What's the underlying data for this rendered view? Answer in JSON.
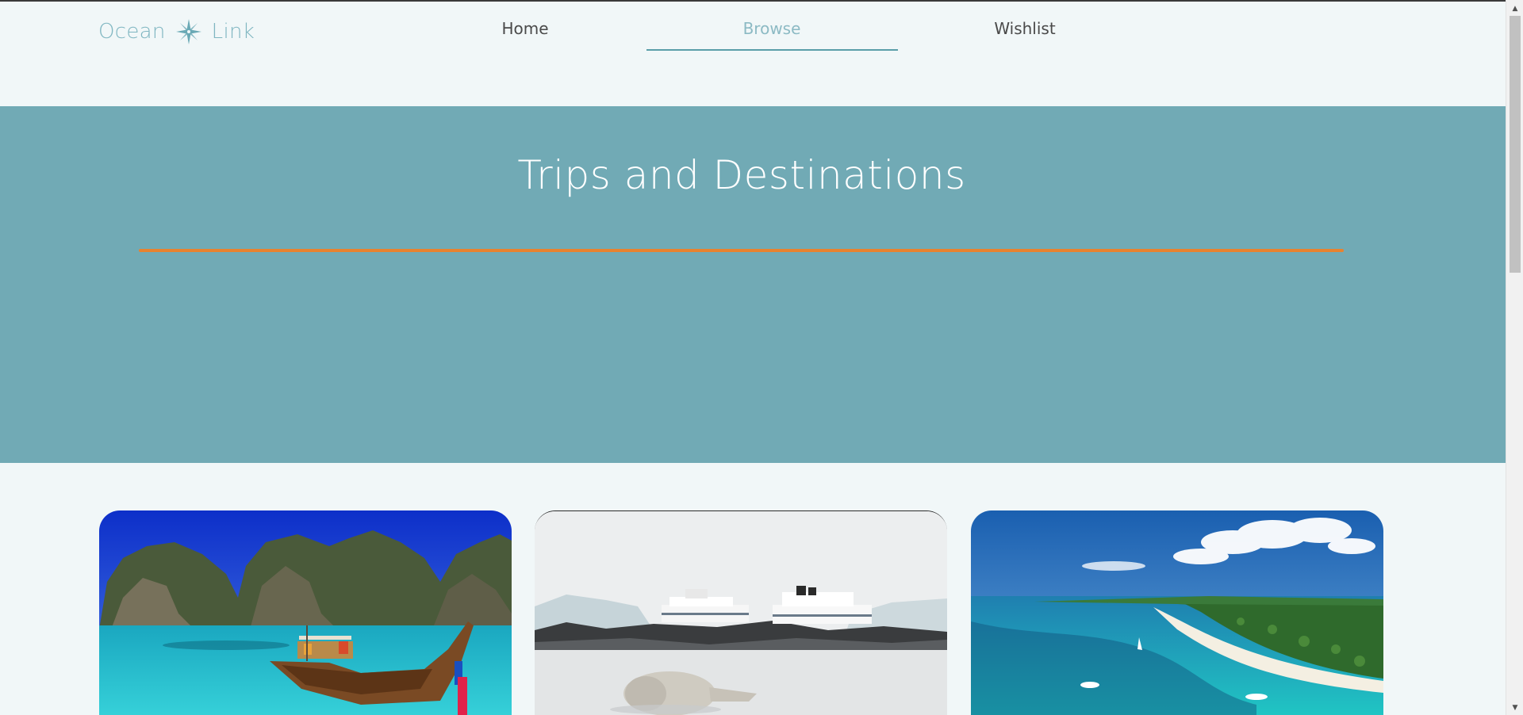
{
  "brand": {
    "name_left": "Ocean",
    "name_right": "Link",
    "icon": "compass-rose-icon",
    "color": "#7fb6c1"
  },
  "nav": {
    "items": [
      {
        "label": "Home",
        "active": false
      },
      {
        "label": "Browse",
        "active": true
      },
      {
        "label": "Wishlist",
        "active": false
      }
    ]
  },
  "hero": {
    "title": "Trips and Destinations",
    "background": "#71aab5",
    "rule_color": "#e8822f"
  },
  "cards": [
    {
      "image": "tropical-cliffs-longtail-boat"
    },
    {
      "image": "antarctic-seal-cruise-ship"
    },
    {
      "image": "caribbean-beach-aerial"
    }
  ]
}
